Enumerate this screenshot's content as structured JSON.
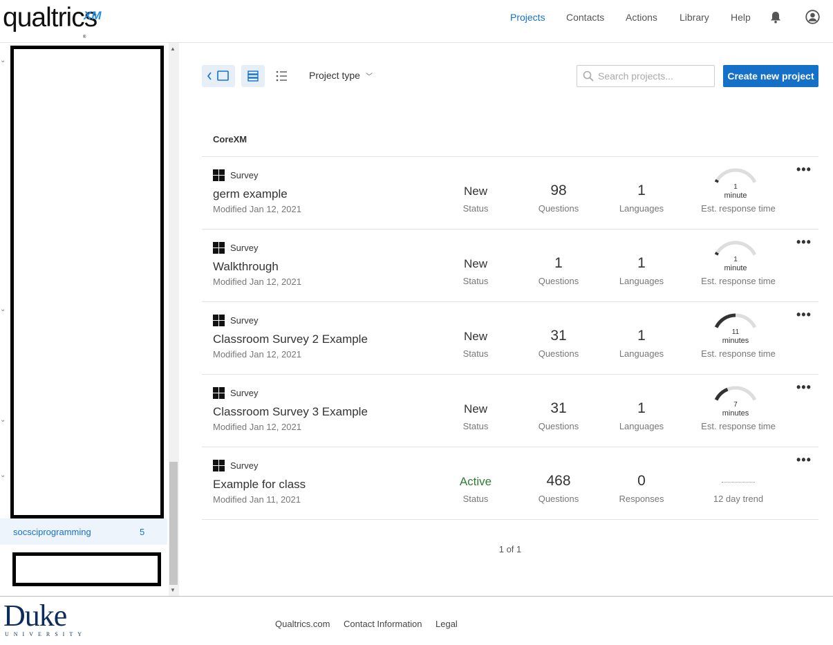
{
  "header": {
    "logo_text": "qualtrics",
    "logo_badge": "XM",
    "nav": [
      "Projects",
      "Contacts",
      "Actions",
      "Library",
      "Help"
    ]
  },
  "sidebar": {
    "selected_item": {
      "label": "socsciprogramming",
      "count": "5"
    }
  },
  "toolbar": {
    "project_type_label": "Project type",
    "search_placeholder": "Search projects...",
    "create_label": "Create new project"
  },
  "section": {
    "title": "CoreXM"
  },
  "projects": [
    {
      "type": "Survey",
      "name": "germ example",
      "modified": "Modified Jan 12, 2021",
      "status": "New",
      "status_label": "Status",
      "questions": "98",
      "questions_label": "Questions",
      "third": "1",
      "third_label": "Languages",
      "est_value": "1",
      "est_unit": "minute",
      "est_label": "Est. response time"
    },
    {
      "type": "Survey",
      "name": "Walkthrough",
      "modified": "Modified Jan 12, 2021",
      "status": "New",
      "status_label": "Status",
      "questions": "1",
      "questions_label": "Questions",
      "third": "1",
      "third_label": "Languages",
      "est_value": "1",
      "est_unit": "minute",
      "est_label": "Est. response time"
    },
    {
      "type": "Survey",
      "name": "Classroom Survey 2 Example",
      "modified": "Modified Jan 12, 2021",
      "status": "New",
      "status_label": "Status",
      "questions": "31",
      "questions_label": "Questions",
      "third": "1",
      "third_label": "Languages",
      "est_value": "11",
      "est_unit": "minutes",
      "est_label": "Est. response time"
    },
    {
      "type": "Survey",
      "name": "Classroom Survey 3 Example",
      "modified": "Modified Jan 12, 2021",
      "status": "New",
      "status_label": "Status",
      "questions": "31",
      "questions_label": "Questions",
      "third": "1",
      "third_label": "Languages",
      "est_value": "7",
      "est_unit": "minutes",
      "est_label": "Est. response time"
    },
    {
      "type": "Survey",
      "name": "Example for class",
      "modified": "Modified Jan 11, 2021",
      "status": "Active",
      "status_label": "Status",
      "questions": "468",
      "questions_label": "Questions",
      "third": "0",
      "third_label": "Responses",
      "trend_label": "12 day trend"
    }
  ],
  "gauge_fill": [
    0.05,
    0.05,
    0.5,
    0.33
  ],
  "pager": "1 of 1",
  "footer": {
    "logo_text": "Duke",
    "logo_sub": "UNIVERSITY",
    "links": [
      "Qualtrics.com",
      "Contact Information",
      "Legal"
    ]
  },
  "colors": {
    "accent": "#1570c8",
    "active_status": "#2e7d32",
    "gauge_fill": "#333333",
    "gauge_track": "#dddddd"
  }
}
